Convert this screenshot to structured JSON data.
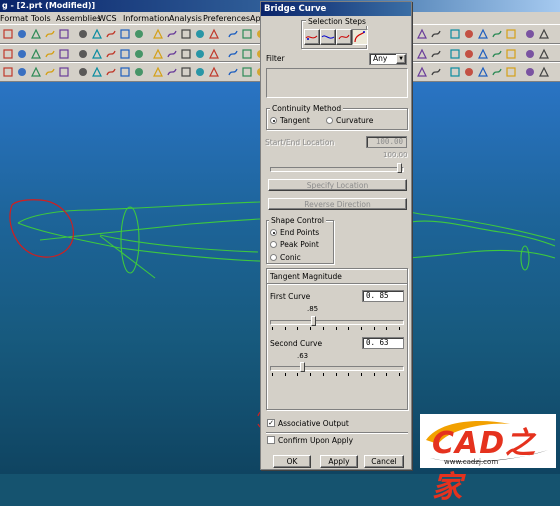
{
  "app": {
    "title": "g - [2.prt (Modified)]",
    "menu": [
      "Format",
      "Tools",
      "Assemblies",
      "WCS",
      "Information",
      "Analysis",
      "Preferences",
      "Ap"
    ]
  },
  "dialog": {
    "title": "Bridge Curve",
    "selection_steps_label": "Selection Steps",
    "filter_label": "Filter",
    "filter_value": "Any",
    "continuity": {
      "label": "Continuity Method",
      "tangent": "Tangent",
      "curvature": "Curvature",
      "selected": "Tangent"
    },
    "start_end": {
      "label": "Start/End Location",
      "value": "100.00",
      "slider_label": "100.00",
      "slider_fraction": 1.0
    },
    "specify_location": "Specify Location",
    "reverse_direction": "Reverse Direction",
    "shape_control": {
      "label": "Shape Control",
      "end_points": "End Points",
      "peak_point": "Peak Point",
      "conic": "Conic",
      "selected": "End Points"
    },
    "tangent_magnitude": {
      "label": "Tangent Magnitude",
      "first_label": "First Curve",
      "first_value": "0. 85",
      "first_slider_label": ".85",
      "first_fraction": 0.32,
      "second_label": "Second Curve",
      "second_value": "0. 63",
      "second_slider_label": ".63",
      "second_fraction": 0.24
    },
    "associative_output": "Associative Output",
    "associative_checked": true,
    "confirm_upon_apply": "Confirm Upon Apply",
    "confirm_checked": false,
    "ok": "OK",
    "apply": "Apply",
    "cancel": "Cancel"
  },
  "logo": {
    "text": "CAD之家",
    "sub": "www.cadzj.com"
  },
  "colors": {
    "curve": "#3ec83e",
    "annotation": "#d21e1e",
    "viewport_top": "#2a74c4",
    "viewport_bottom": "#0f4461",
    "logo_red": "#e5321e"
  }
}
